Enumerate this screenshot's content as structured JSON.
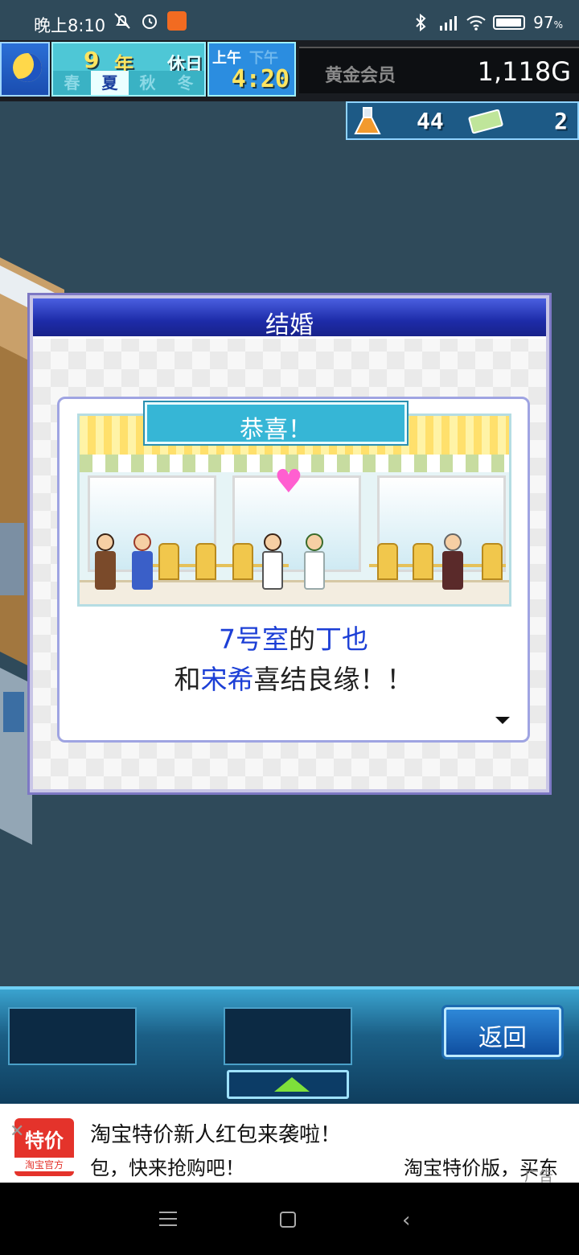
{
  "status_bar": {
    "time": "晚上8:10",
    "battery": "97",
    "battery_unit": "%",
    "icons": [
      "mute-icon",
      "alarm-icon",
      "app-notification-icon",
      "bluetooth-icon",
      "signal-icon",
      "wifi-icon",
      "battery-icon"
    ]
  },
  "hud": {
    "year_num": "9",
    "year_label": "年",
    "day_label": "休日",
    "seasons": [
      "春",
      "夏",
      "秋",
      "冬"
    ],
    "active_season": "夏",
    "am_label": "上午",
    "pm_label": "下午",
    "clock": "4:20",
    "member_label": "黄金会员",
    "gold": "1,118G",
    "research_points": "44",
    "tickets": "2"
  },
  "dialog": {
    "title": "结婚",
    "banner": "恭喜！",
    "line1_room": "7号室",
    "line1_particle": "的",
    "line1_name": "丁也",
    "line2_prefix": "和",
    "line2_name": "宋希",
    "line2_suffix": "喜结良缘！！"
  },
  "bottom_bar": {
    "back_label": "返回"
  },
  "ad": {
    "logo_main": "特价",
    "logo_sub": "淘宝官方",
    "line1": "淘宝特价新人红包来袭啦！",
    "line2": "包，快来抢购吧！",
    "right_text": "淘宝特价版，买东",
    "tag": "广告"
  },
  "colors": {
    "background": "#2f4a5a",
    "dialog_title_bar": "#1d2ba8",
    "highlight_text": "#1c3fd6",
    "banner": "#36b6d6",
    "back_button": "#0f4ea0",
    "ad_red": "#e4332b"
  }
}
